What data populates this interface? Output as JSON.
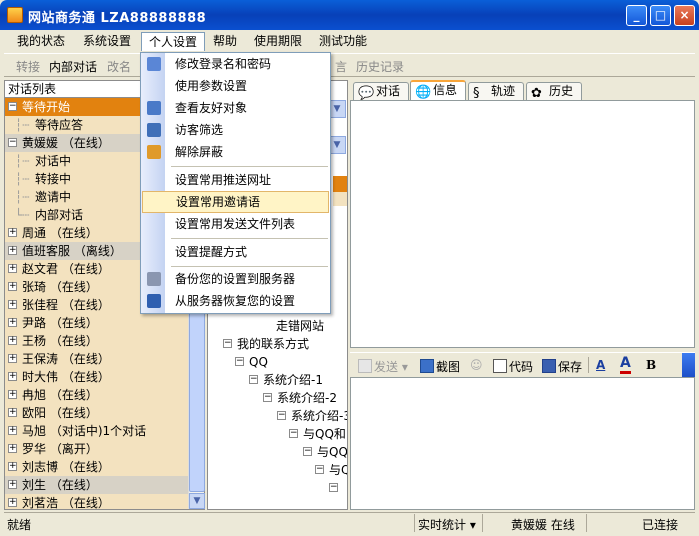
{
  "window": {
    "title": "网站商务通   LZA88888888",
    "min_label": "_",
    "max_label": "□",
    "close_label": "×"
  },
  "menubar": {
    "items": [
      "我的状态",
      "系统设置",
      "个人设置",
      "帮助",
      "使用期限",
      "测试功能"
    ]
  },
  "toolbar": {
    "transfer": "转接",
    "internal": "内部对话",
    "rename": "改名",
    "message": "言",
    "history": "历史记录"
  },
  "left_panel": {
    "header": "对话列表",
    "rows": [
      {
        "label": "等待开始",
        "level": 0,
        "expander": "−"
      },
      {
        "label": "等待应答",
        "level": 1
      },
      {
        "label": "黄媛媛 （在线）",
        "level": 0,
        "expander": "−"
      },
      {
        "label": "对话中",
        "level": 1
      },
      {
        "label": "转接中",
        "level": 1
      },
      {
        "label": "邀请中",
        "level": 1
      },
      {
        "label": "内部对话",
        "level": 1
      },
      {
        "label": "周通 （在线）",
        "level": 0,
        "expander": "+"
      },
      {
        "label": "值班客服 （离线）",
        "level": 0,
        "expander": "+"
      },
      {
        "label": "赵文君 （在线）",
        "level": 0,
        "expander": "+"
      },
      {
        "label": "张琦 （在线）",
        "level": 0,
        "expander": "+"
      },
      {
        "label": "张佳程 （在线）",
        "level": 0,
        "expander": "+"
      },
      {
        "label": "尹路 （在线）",
        "level": 0,
        "expander": "+"
      },
      {
        "label": "王杨 （在线）",
        "level": 0,
        "expander": "+"
      },
      {
        "label": "王保涛 （在线）",
        "level": 0,
        "expander": "+"
      },
      {
        "label": "时大伟 （在线）",
        "level": 0,
        "expander": "+"
      },
      {
        "label": "冉旭 （在线）",
        "level": 0,
        "expander": "+"
      },
      {
        "label": "欧阳 （在线）",
        "level": 0,
        "expander": "+"
      },
      {
        "label": "马旭 （对话中)1个对话",
        "level": 0,
        "expander": "+"
      },
      {
        "label": "罗华 （离开）",
        "level": 0,
        "expander": "+"
      },
      {
        "label": "刘志博 （在线）",
        "level": 0,
        "expander": "+"
      },
      {
        "label": "刘生 （在线）",
        "level": 0,
        "expander": "+"
      },
      {
        "label": "刘茗浩 （在线）",
        "level": 0,
        "expander": "+"
      }
    ]
  },
  "mid_panel": {
    "rows": [
      {
        "label": "走错网站"
      },
      {
        "label": "我的联系方式",
        "expander": "−"
      },
      {
        "label": "QQ",
        "expander": "−"
      },
      {
        "label": "系统介绍-1",
        "expander": "−"
      },
      {
        "label": "系统介绍-2",
        "expander": "−"
      },
      {
        "label": "系统介绍-3",
        "expander": "−"
      },
      {
        "label": "与QQ和MS",
        "expander": "−"
      },
      {
        "label": "与QQ的",
        "expander": "−"
      },
      {
        "label": "与Q",
        "expander": "−"
      },
      {
        "label": "",
        "expander": "−"
      }
    ]
  },
  "tabs": [
    "对话",
    "信息",
    "轨迹",
    "历史"
  ],
  "input_toolbar": {
    "send": "发送",
    "screenshot": "截图",
    "code": "代码",
    "save": "保存",
    "bold": "B"
  },
  "statusbar": {
    "ready": "就绪",
    "stats": "实时统计",
    "user": "黄媛媛  在线",
    "conn": "已连接"
  },
  "dropdown": {
    "items": [
      "修改登录名和密码",
      "使用参数设置",
      "查看友好对象",
      "访客筛选",
      "解除屏蔽",
      "设置常用推送网址",
      "设置常用邀请语",
      "设置常用发送文件列表",
      "设置提醒方式",
      "备份您的设置到服务器",
      "从服务器恢复您的设置"
    ]
  },
  "colors": {
    "title_blue": "#0840b8",
    "selected_orange": "#e2820f",
    "panel_tan": "#f3e2bf",
    "menu_highlight": "#fff4c6"
  }
}
